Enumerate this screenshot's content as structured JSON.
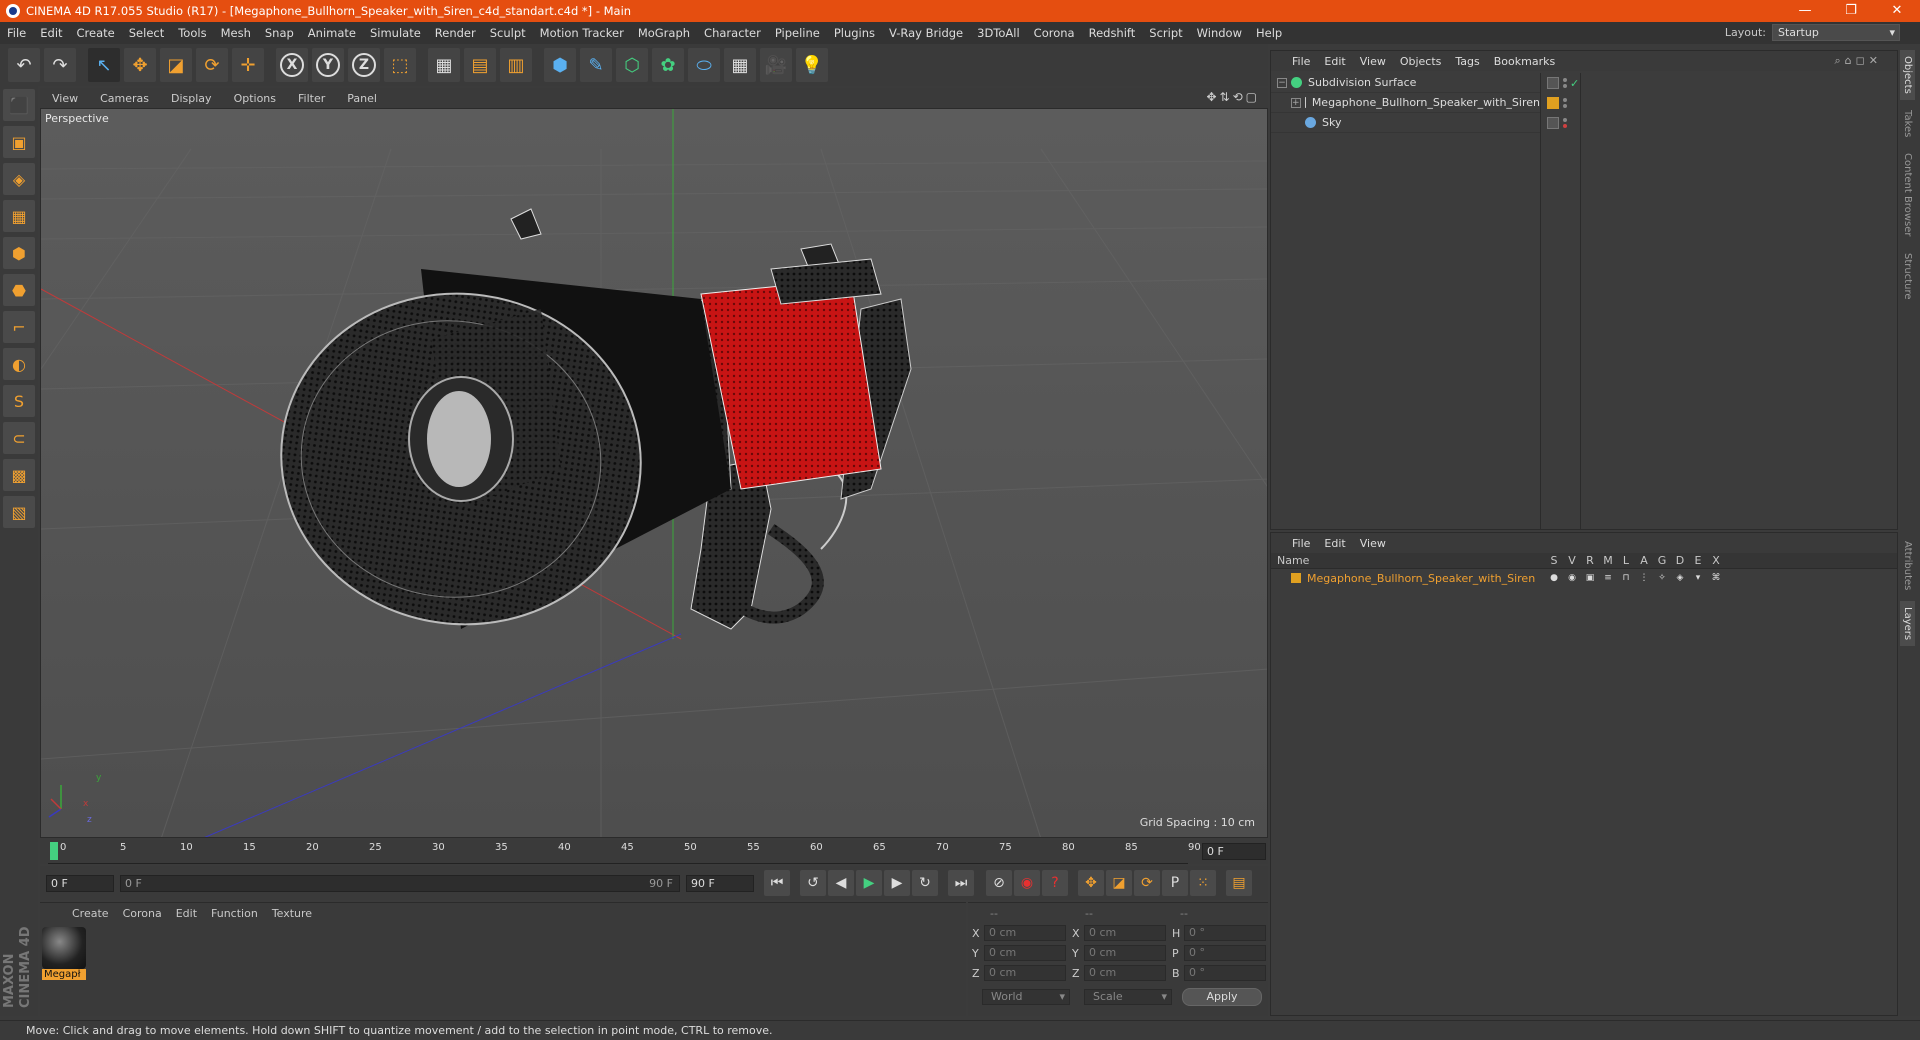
{
  "titlebar": {
    "title": "CINEMA 4D R17.055 Studio (R17) - [Megaphone_Bullhorn_Speaker_with_Siren_c4d_standart.c4d *] - Main",
    "minimize": "—",
    "restore": "❐",
    "close": "✕"
  },
  "menubar": {
    "items": [
      "File",
      "Edit",
      "Create",
      "Select",
      "Tools",
      "Mesh",
      "Snap",
      "Animate",
      "Simulate",
      "Render",
      "Sculpt",
      "Motion Tracker",
      "MoGraph",
      "Character",
      "Pipeline",
      "Plugins",
      "V-Ray Bridge",
      "3DToAll",
      "Corona",
      "Redshift",
      "Script",
      "Window",
      "Help"
    ],
    "layout_label": "Layout:",
    "layout_value": "Startup"
  },
  "toolbar": {
    "undo": "↶",
    "redo": "↷",
    "select": "↖",
    "move": "✥",
    "scale": "◪",
    "rotate": "⟳",
    "live": "✛",
    "x": "X",
    "y": "Y",
    "z": "Z",
    "coord": "⬚",
    "render_view": "▦",
    "render_pic": "▤",
    "render_settings": "▥",
    "cube": "⬢",
    "pen": "✎",
    "subdiv": "⬡",
    "cloner": "✿",
    "deformer": "⬭",
    "floor": "▦",
    "camera": "🎥",
    "light": "💡"
  },
  "lefttoolbar": {
    "items": [
      "⬛",
      "▣",
      "◈",
      "▦",
      "⬢",
      "⬣",
      "⌐",
      "◐",
      "S",
      "⊂",
      "▩",
      "▧"
    ],
    "brand_top": "MAXON",
    "brand_bottom": "CINEMA 4D"
  },
  "viewport": {
    "menu": [
      "View",
      "Cameras",
      "Display",
      "Options",
      "Filter",
      "Panel"
    ],
    "nav_icons": "✥⇅⟲▢",
    "label": "Perspective",
    "grid_spacing": "Grid Spacing : 10 cm",
    "axis_y": "y",
    "axis_x": "x",
    "axis_z": "z"
  },
  "timeline": {
    "ticks": [
      "0",
      "5",
      "10",
      "15",
      "20",
      "25",
      "30",
      "35",
      "40",
      "45",
      "50",
      "55",
      "60",
      "65",
      "70",
      "75",
      "80",
      "85",
      "90"
    ],
    "current_frame": "0 F",
    "start_field": "0 F",
    "range_start": "0 F",
    "range_end": "90 F",
    "end_field": "90 F"
  },
  "material_manager": {
    "menu": [
      "Create",
      "Corona",
      "Edit",
      "Function",
      "Texture"
    ],
    "materials": [
      {
        "name": "Megapł"
      }
    ]
  },
  "coordinates": {
    "headers": [
      "--",
      "--",
      "--"
    ],
    "rows": [
      {
        "a1": "X",
        "v1": "0 cm",
        "a2": "X",
        "v2": "0 cm",
        "a3": "H",
        "v3": "0 °"
      },
      {
        "a1": "Y",
        "v1": "0 cm",
        "a2": "Y",
        "v2": "0 cm",
        "a3": "P",
        "v3": "0 °"
      },
      {
        "a1": "Z",
        "v1": "0 cm",
        "a2": "Z",
        "v2": "0 cm",
        "a3": "B",
        "v3": "0 °"
      }
    ],
    "space": "World",
    "mode": "Scale",
    "apply": "Apply"
  },
  "status": "Move: Click and drag to move elements. Hold down SHIFT to quantize movement / add to the selection in point mode, CTRL to remove.",
  "object_manager": {
    "menu": [
      "File",
      "Edit",
      "View",
      "Objects",
      "Tags",
      "Bookmarks"
    ],
    "icons": "⌕⌂◻✕",
    "objects": [
      {
        "name": "Subdivision Surface",
        "color": "#44d080"
      },
      {
        "name": "Megaphone_Bullhorn_Speaker_with_Siren",
        "color": "#cccccc"
      },
      {
        "name": "Sky",
        "color": "#6aa8e0"
      }
    ]
  },
  "layer_manager": {
    "menu": [
      "File",
      "Edit",
      "View"
    ],
    "columns": [
      "Name",
      "S",
      "V",
      "R",
      "M",
      "L",
      "A",
      "G",
      "D",
      "E",
      "X"
    ],
    "layers": [
      {
        "name": "Megaphone_Bullhorn_Speaker_with_Siren",
        "color": "#e0a020"
      }
    ]
  },
  "right_tabs": [
    "Objects",
    "Takes",
    "Content Browser",
    "Structure",
    "Attributes",
    "Layers"
  ]
}
